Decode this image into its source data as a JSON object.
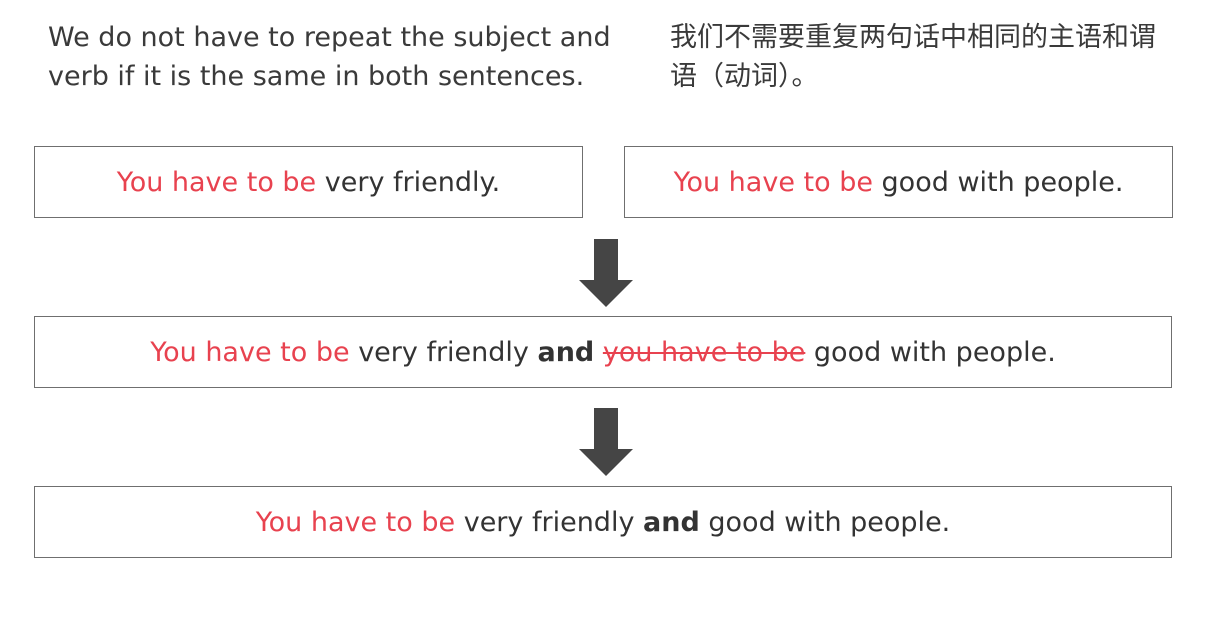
{
  "intro": {
    "english": "We do not have to repeat the subject and verb if it is the same in both sentences.",
    "chinese": "我们不需要重复两句话中相同的主语和谓语（动词）。"
  },
  "boxes": {
    "sentence1": {
      "highlight": "You have to be",
      "rest": "very friendly."
    },
    "sentence2": {
      "highlight": "You have to be",
      "rest": "good with people."
    },
    "combined": {
      "highlight": "You have to be",
      "part1": "very friendly",
      "conjunction": "and",
      "struck": "you have to be",
      "part2": "good with people."
    },
    "result": {
      "highlight": "You have to be",
      "part1": "very friendly",
      "conjunction": "and",
      "part2": "good with people."
    }
  },
  "colors": {
    "highlight": "#e8424f",
    "text": "#333333",
    "arrow": "#454545",
    "border": "#6f6f6f"
  },
  "icons": [
    "down-arrow-icon",
    "down-arrow-icon"
  ]
}
